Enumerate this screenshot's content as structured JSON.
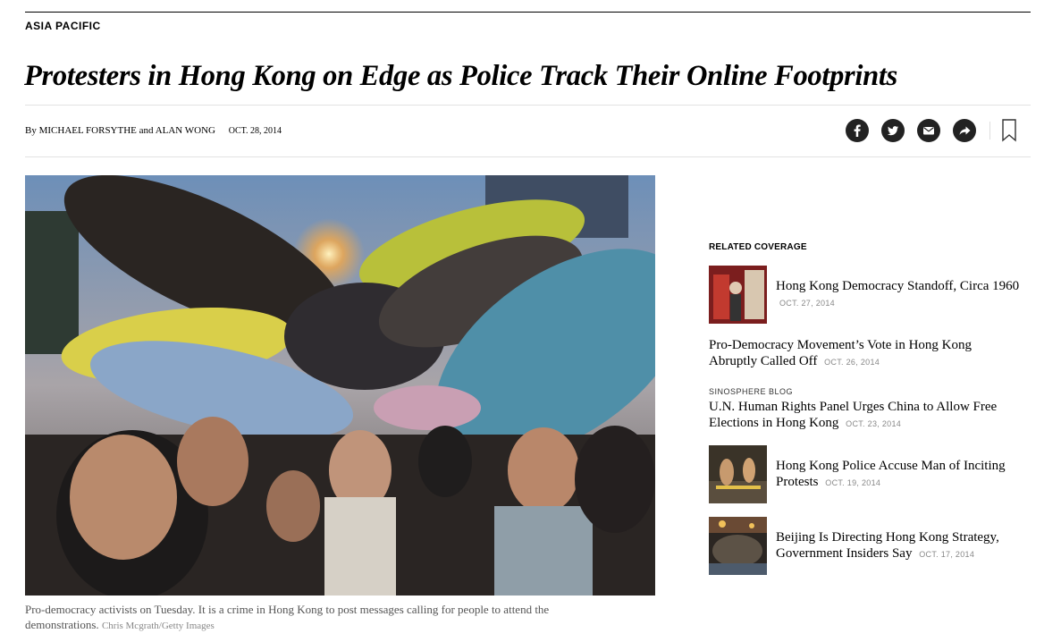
{
  "section": "ASIA PACIFIC",
  "headline": "Protesters in Hong Kong on Edge as Police Track Their Online Footprints",
  "byline": {
    "by": "By",
    "author1": "MICHAEL FORSYTHE",
    "and": "and",
    "author2": "ALAN WONG",
    "date": "OCT. 28, 2014"
  },
  "share_icons": [
    "facebook-icon",
    "twitter-icon",
    "email-icon",
    "share-icon",
    "bookmark-icon"
  ],
  "photo": {
    "caption": "Pro-democracy activists on Tuesday. It is a crime in Hong Kong to post messages calling for people to attend the demonstrations.",
    "credit": "Chris Mcgrath/Getty Images"
  },
  "related": {
    "heading": "RELATED COVERAGE",
    "items": [
      {
        "title": "Hong Kong Democracy Standoff, Circa 1960",
        "date": "OCT. 27, 2014",
        "kicker": ""
      },
      {
        "title": "Pro-Democracy Movement’s Vote in Hong Kong Abruptly Called Off",
        "date": "OCT. 26, 2014",
        "kicker": ""
      },
      {
        "title": "U.N. Human Rights Panel Urges China to Allow Free Elections in Hong Kong",
        "date": "OCT. 23, 2014",
        "kicker": "SINOSPHERE BLOG"
      },
      {
        "title": "Hong Kong Police Accuse Man of Inciting Protests",
        "date": "OCT. 19, 2014",
        "kicker": ""
      },
      {
        "title": "Beijing Is Directing Hong Kong Strategy, Government Insiders Say",
        "date": "OCT. 17, 2014",
        "kicker": ""
      }
    ]
  }
}
